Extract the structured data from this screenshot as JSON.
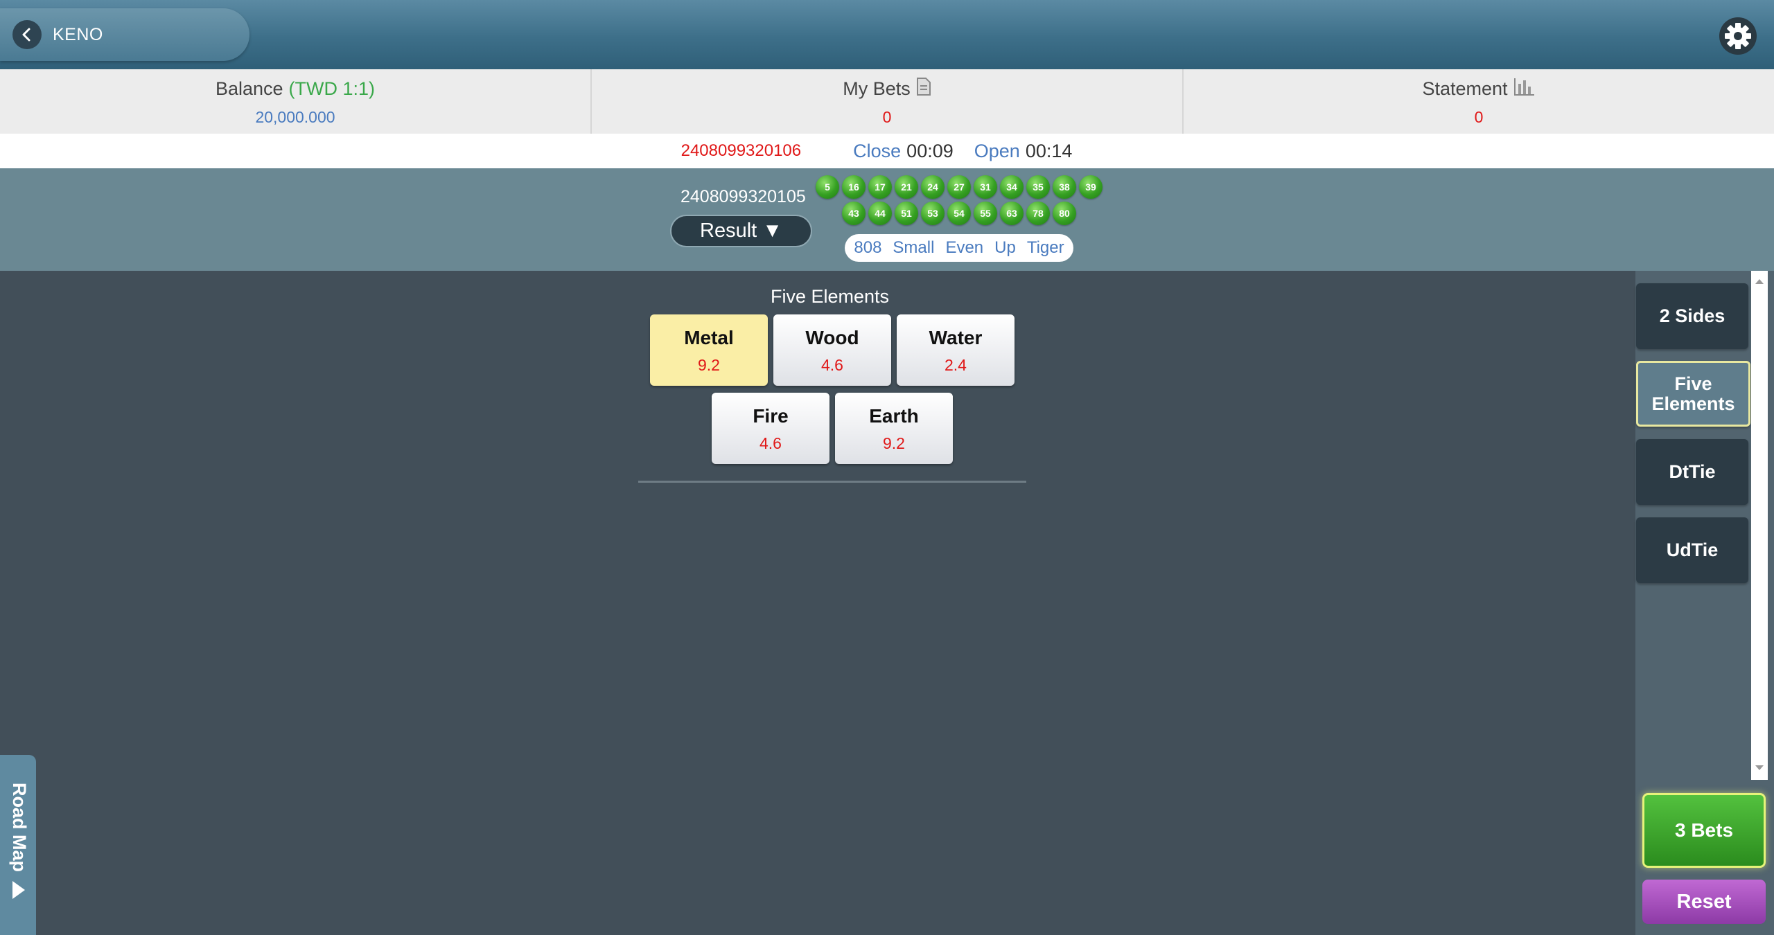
{
  "header": {
    "title": "KENO",
    "back_icon": "chevron-left-icon",
    "settings_icon": "gear-icon"
  },
  "info": {
    "balance": {
      "label": "Balance",
      "currency": "(TWD 1:1)",
      "value": "20,000.000"
    },
    "my_bets": {
      "label": "My Bets",
      "value": "0"
    },
    "statement": {
      "label": "Statement",
      "value": "0"
    }
  },
  "timer": {
    "draw_number": "2408099320106",
    "close_label": "Close",
    "close_time": "00:09",
    "open_label": "Open",
    "open_time": "00:14"
  },
  "result": {
    "draw_number": "2408099320105",
    "button_label": "Result ▼",
    "balls_row1": [
      "5",
      "16",
      "17",
      "21",
      "24",
      "27",
      "31",
      "34",
      "35",
      "38",
      "39"
    ],
    "balls_row2": [
      "43",
      "44",
      "51",
      "53",
      "54",
      "55",
      "63",
      "78",
      "80"
    ],
    "summary": [
      "808",
      "Small",
      "Even",
      "Up",
      "Tiger"
    ]
  },
  "section": {
    "title": "Five Elements",
    "bets": [
      {
        "name": "Metal",
        "odds": "9.2",
        "selected": true
      },
      {
        "name": "Wood",
        "odds": "4.6",
        "selected": false
      },
      {
        "name": "Water",
        "odds": "2.4",
        "selected": false
      },
      {
        "name": "Fire",
        "odds": "4.6",
        "selected": false
      },
      {
        "name": "Earth",
        "odds": "9.2",
        "selected": false
      }
    ]
  },
  "sidebar": {
    "tabs": [
      {
        "label": "2 Sides",
        "active": false
      },
      {
        "label": "Five Elements",
        "active": true
      },
      {
        "label": "DtTie",
        "active": false
      },
      {
        "label": "UdTie",
        "active": false
      }
    ],
    "bets_button": "3 Bets",
    "reset_button": "Reset"
  },
  "roadmap": {
    "label": "Road Map"
  },
  "colors": {
    "accent_green": "#3aa84a",
    "link_blue": "#4a7bbf",
    "alert_red": "#e01818",
    "selected_yellow": "#faeea6"
  }
}
